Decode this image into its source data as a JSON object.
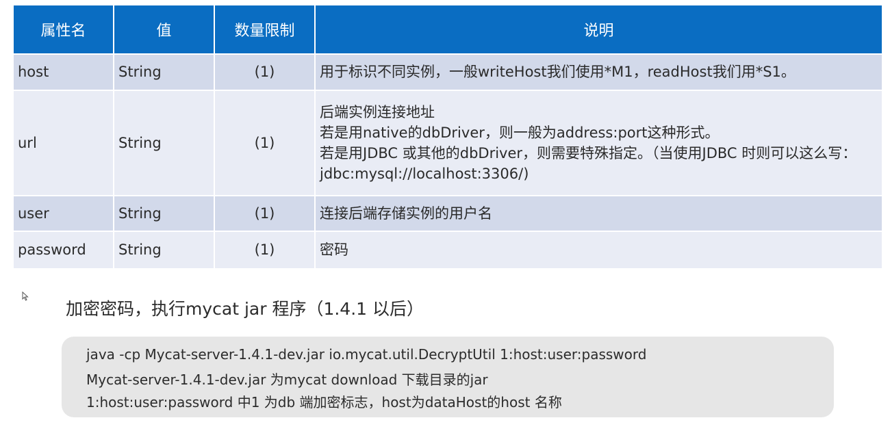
{
  "table": {
    "headers": [
      "属性名",
      "值",
      "数量限制",
      "说明"
    ],
    "rows": [
      {
        "name": "host",
        "value": "String",
        "limit": "(1)",
        "desc": [
          "用于标识不同实例，一般writeHost我们使用*M1，readHost我们用*S1。"
        ]
      },
      {
        "name": "url",
        "value": "String",
        "limit": "(1)",
        "desc": [
          "后端实例连接地址",
          "若是用native的dbDriver，则一般为address:port这种形式。",
          "若是用JDBC 或其他的dbDriver，则需要特殊指定。（当使用JDBC 时则可以这么写：",
          "jdbc:mysql://localhost:3306/)"
        ]
      },
      {
        "name": "user",
        "value": "String",
        "limit": "(1)",
        "desc": [
          "连接后端存储实例的用户名"
        ]
      },
      {
        "name": "password",
        "value": "String",
        "limit": "(1)",
        "desc": [
          "密码"
        ]
      }
    ]
  },
  "heading": "加密密码，执行mycat jar 程序（1.4.1 以后）",
  "code": {
    "lines": [
      "java -cp Mycat-server-1.4.1-dev.jar io.mycat.util.DecryptUtil 1:host:user:password",
      "Mycat-server-1.4.1-dev.jar 为mycat download 下载目录的jar",
      "1:host:user:password 中1 为db 端加密标志，host为dataHost的host 名称"
    ]
  },
  "colors": {
    "header_bg": "#0a6dc2",
    "row_odd": "#d2d9ea",
    "row_even": "#e9ecf5",
    "code_bg": "#e6e6e6"
  }
}
